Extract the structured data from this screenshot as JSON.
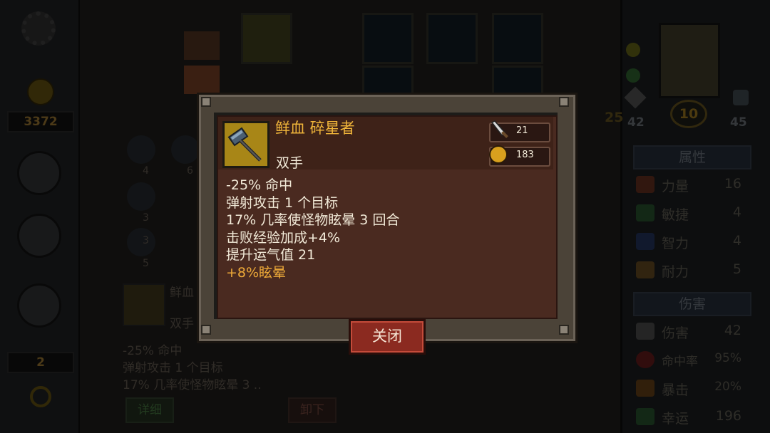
{
  "left_sidebar": {
    "gold": "3372",
    "count": "2"
  },
  "hero": {
    "level": "10",
    "left_stat": "42",
    "right_stat": "45",
    "side_num": "25"
  },
  "right_panel": {
    "attributes_header": "属性",
    "attributes": [
      {
        "name": "力量",
        "value": "16",
        "color": "#7a3a28"
      },
      {
        "name": "敏捷",
        "value": "4",
        "color": "#2f6a38"
      },
      {
        "name": "智力",
        "value": "4",
        "color": "#26407a"
      },
      {
        "name": "耐力",
        "value": "5",
        "color": "#7a5a28"
      }
    ],
    "damage_header": "伤害",
    "damage": [
      {
        "name": "伤害",
        "value": "42",
        "color": "#666"
      },
      {
        "name": "命中率",
        "value": "95%",
        "color": "#7a2020"
      },
      {
        "name": "暴击",
        "value": "20%",
        "color": "#8a5a1a"
      },
      {
        "name": "幸运",
        "value": "196",
        "color": "#2f6a38"
      }
    ]
  },
  "bg_item": {
    "name": "鲜血",
    "hand": "双手",
    "lines": [
      "-25% 命中",
      "弹射攻击 1 个目标",
      "17% 几率使怪物眩晕 3 .."
    ],
    "details_button": "详细",
    "unequip_button": "卸下"
  },
  "bg_slots": {
    "numbers": [
      "4",
      "6",
      "3",
      "3",
      "5"
    ]
  },
  "dialog": {
    "title": "鲜血 碎星者",
    "subtitle": "双手",
    "damage_value": "21",
    "price": "183",
    "effects": [
      "-25% 命中",
      "弹射攻击 1 个目标",
      "17% 几率使怪物眩晕 3 回合",
      "击败经验加成+4%",
      "提升运气值 21"
    ],
    "bonus_effect": "+8%眩晕",
    "close_button": "关闭"
  },
  "colors": {
    "title": "#f0b53a",
    "bonus": "#eeaa38",
    "card_bg": "#4a2a20",
    "button": "#8b2a20"
  }
}
